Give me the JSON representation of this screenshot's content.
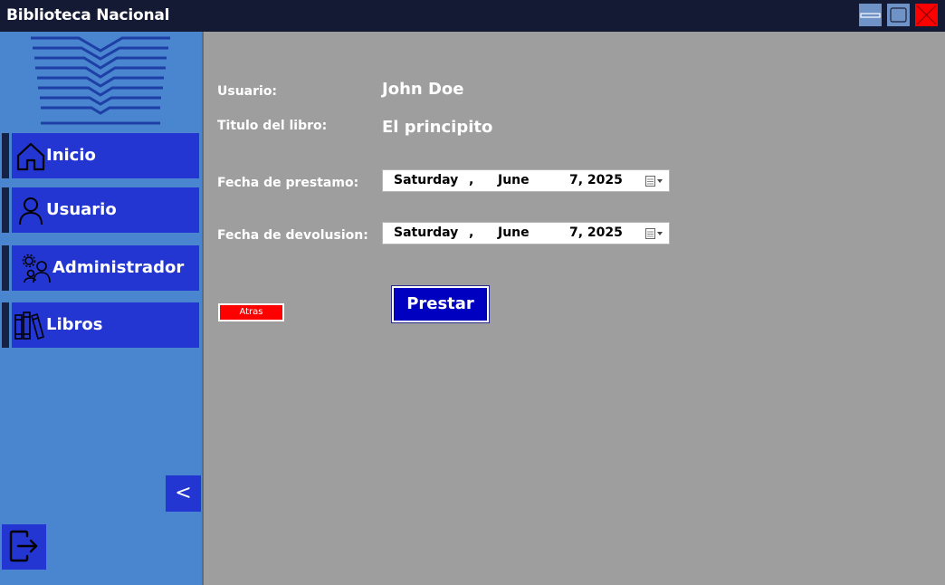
{
  "window": {
    "title": "Biblioteca Nacional",
    "controls": [
      "minimize-icon",
      "maximize-icon",
      "close-icon"
    ]
  },
  "sidebar": {
    "items": [
      {
        "label": "Inicio",
        "icon": "home-icon"
      },
      {
        "label": "Usuario",
        "icon": "user-icon"
      },
      {
        "label": "Administrador",
        "icon": "admin-users-icon"
      },
      {
        "label": "Libros",
        "icon": "books-icon"
      }
    ],
    "collapse_label": "<",
    "logout_icon": "logout-icon"
  },
  "form": {
    "user_label": "Usuario:",
    "user_value": "John Doe",
    "book_label": "Titulo del libro:",
    "book_value": "El principito",
    "loan_date_label": "Fecha de prestamo:",
    "loan_date": {
      "weekday": "Saturday",
      "sep": ",",
      "month": "June",
      "day_year": "7, 2025"
    },
    "return_date_label": "Fecha de devolusion:",
    "return_date": {
      "weekday": "Saturday",
      "sep": ",",
      "month": "June",
      "day_year": "7, 2025"
    },
    "back_label": "Atras",
    "submit_label": "Prestar"
  },
  "colors": {
    "titlebar": "#141a33",
    "sidebar": "#4a86d0",
    "nav_button": "#2336d1",
    "content_bg": "#9e9e9e",
    "back_button": "#ff0000",
    "submit_button": "#0000c0"
  }
}
